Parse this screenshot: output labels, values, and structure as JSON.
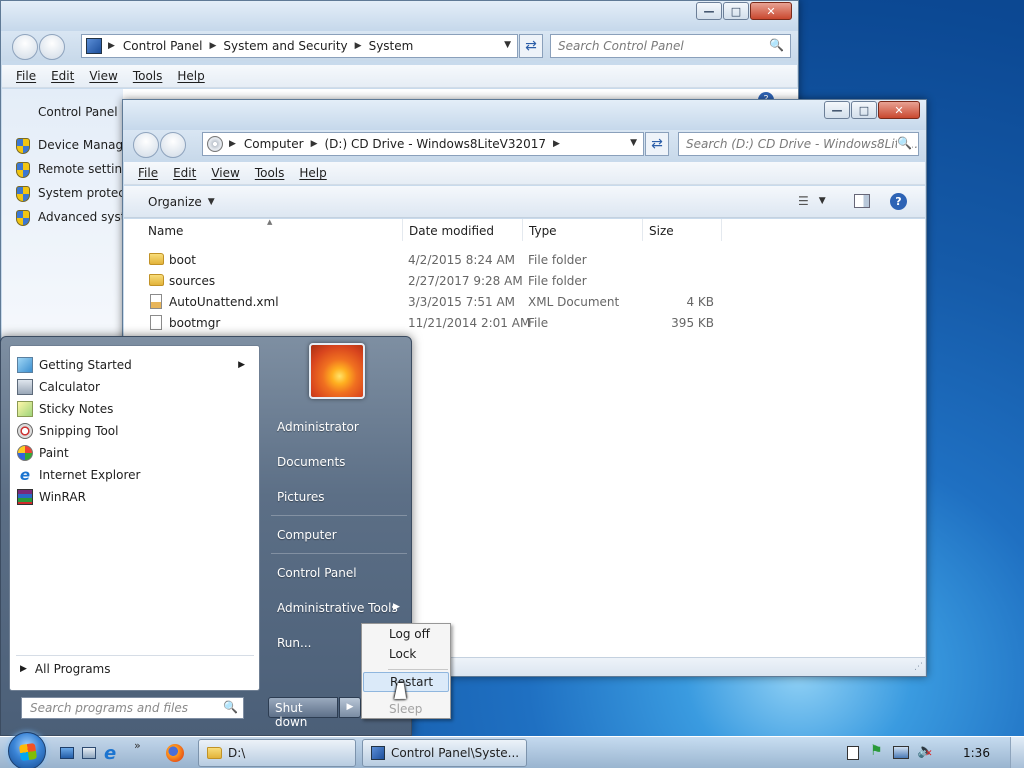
{
  "cp_window": {
    "address": [
      "Control Panel",
      "System and Security",
      "System"
    ],
    "search_placeholder": "Search Control Panel",
    "menu": [
      "File",
      "Edit",
      "View",
      "Tools",
      "Help"
    ],
    "home_label": "Control Panel H",
    "tasks": [
      "Device Manager",
      "Remote settings",
      "System protection",
      "Advanced system"
    ]
  },
  "explorer": {
    "address": [
      "Computer",
      "(D:) CD Drive - Windows8LiteV32017"
    ],
    "search_placeholder": "Search (D:) CD Drive - Windows8Lite...",
    "menu": [
      "File",
      "Edit",
      "View",
      "Tools",
      "Help"
    ],
    "organize_label": "Organize",
    "columns": [
      "Name",
      "Date modified",
      "Type",
      "Size"
    ],
    "files": [
      {
        "name": "boot",
        "date": "4/2/2015 8:24 AM",
        "type": "File folder",
        "size": "",
        "icon": "folder-icon"
      },
      {
        "name": "sources",
        "date": "2/27/2017 9:28 AM",
        "type": "File folder",
        "size": "",
        "icon": "folder-icon"
      },
      {
        "name": "AutoUnattend.xml",
        "date": "3/3/2015 7:51 AM",
        "type": "XML Document",
        "size": "4 KB",
        "icon": "xml-file-icon"
      },
      {
        "name": "bootmgr",
        "date": "11/21/2014 2:01 AM",
        "type": "File",
        "size": "395 KB",
        "icon": "file-icon"
      }
    ]
  },
  "start_menu": {
    "programs": [
      {
        "label": "Getting Started",
        "icon": "getting-started-icon",
        "arrow": true
      },
      {
        "label": "Calculator",
        "icon": "calculator-icon"
      },
      {
        "label": "Sticky Notes",
        "icon": "sticky-notes-icon"
      },
      {
        "label": "Snipping Tool",
        "icon": "snipping-tool-icon"
      },
      {
        "label": "Paint",
        "icon": "paint-icon"
      },
      {
        "label": "Internet Explorer",
        "icon": "internet-explorer-icon"
      },
      {
        "label": "WinRAR",
        "icon": "winrar-icon"
      }
    ],
    "all_programs": "All Programs",
    "search_placeholder": "Search programs and files",
    "right_items": [
      "Administrator",
      "Documents",
      "Pictures",
      "Computer",
      "Control Panel",
      "Administrative Tools",
      "Run..."
    ],
    "shutdown_label": "Shut down"
  },
  "power_menu": [
    "Log off",
    "Lock",
    "Restart",
    "Sleep"
  ],
  "taskbar": {
    "buttons": [
      "D:\\",
      "Control Panel\\Syste..."
    ],
    "clock": "1:36"
  },
  "colors": {
    "accent": "#1f70c2",
    "selection": "#cce8ff"
  }
}
